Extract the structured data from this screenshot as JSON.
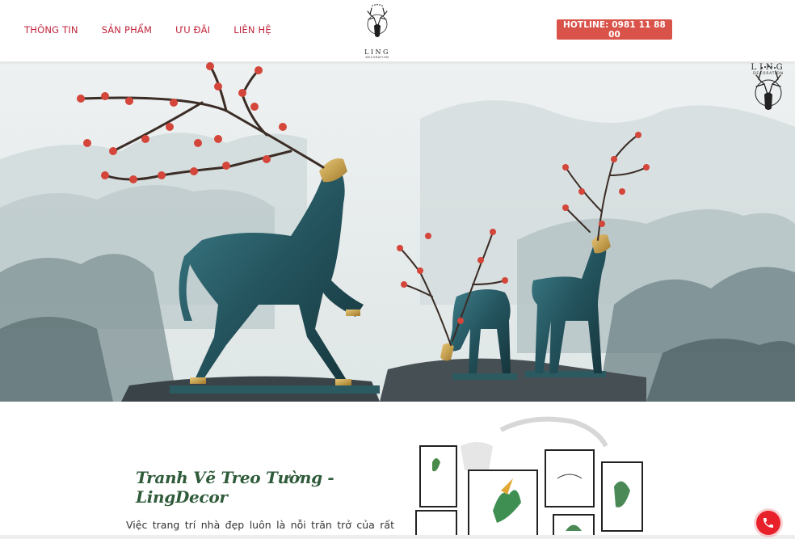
{
  "nav": {
    "items": [
      "THÔNG TIN",
      "SẢN PHẨM",
      "ƯU ĐÃI",
      "LIÊN HỆ"
    ]
  },
  "logo": {
    "name": "LING",
    "sub": "DECORATION"
  },
  "hotline": {
    "label": "HOTLINE: 0981 11 88 00"
  },
  "hero": {
    "logo_name": "LING",
    "logo_sub": "DECORATION"
  },
  "content": {
    "title": "Tranh Vẽ Treo Tường - LingDecor",
    "paragraph": "Việc trang trí nhà đẹp luôn là nỗi trăn trở của rất nhiều"
  },
  "colors": {
    "accent_red": "#d9534a",
    "nav_text": "#c0243c",
    "title_green": "#2f5b3a",
    "call_red": "#e8202a"
  },
  "icons": [
    "deer-logo-icon",
    "phone-icon"
  ]
}
